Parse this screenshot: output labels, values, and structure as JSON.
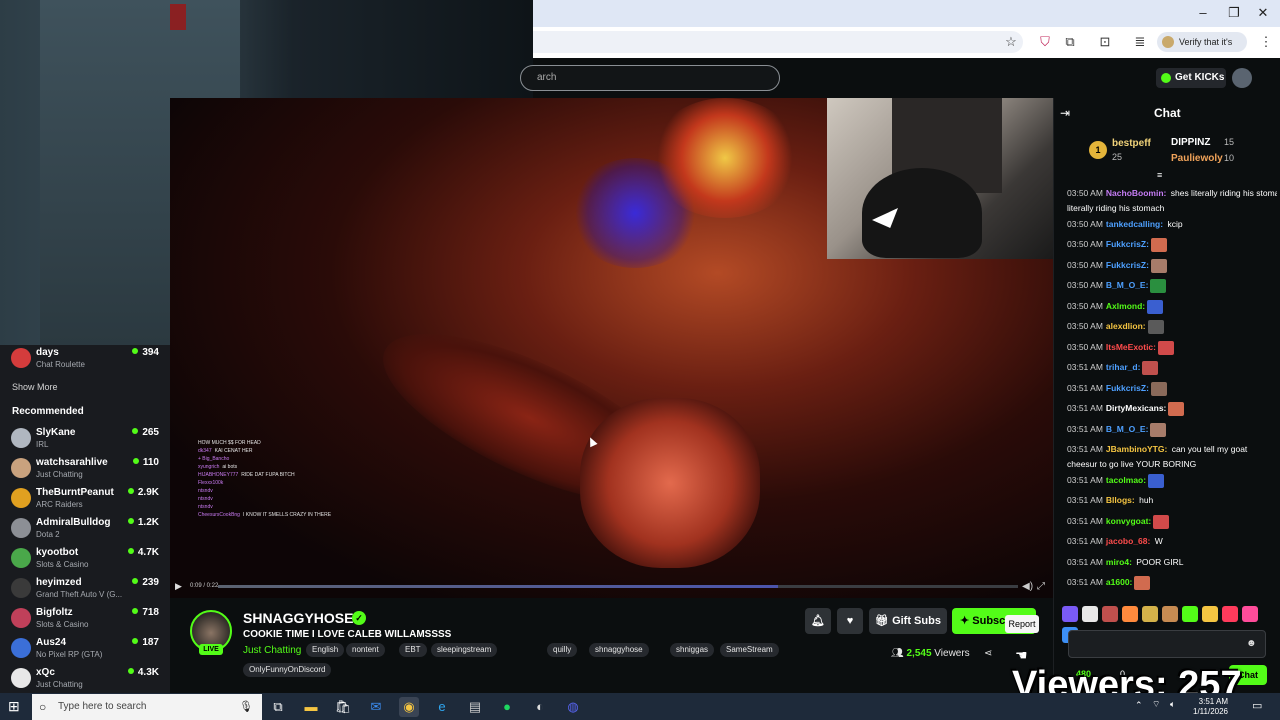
{
  "browser": {
    "search_placeholder": "arch",
    "verify_chip": "Verify that it's you",
    "window_controls": [
      "minimize-icon",
      "restore-icon",
      "close-icon"
    ]
  },
  "kick": {
    "get_kicks": "Get KICKs",
    "brand_color": "#53fc18"
  },
  "sidebar": {
    "following_top": {
      "name": "days",
      "category": "Chat Roulette",
      "viewers": "394"
    },
    "show_more": "Show More",
    "recommended_label": "Recommended",
    "recommended": [
      {
        "name": "SlyKane",
        "category": "IRL",
        "viewers": "265",
        "color": "#b0b7c0"
      },
      {
        "name": "watchsarahlive",
        "category": "Just Chatting",
        "viewers": "110",
        "color": "#c9a27e"
      },
      {
        "name": "TheBurntPeanut",
        "category": "ARC Raiders",
        "viewers": "2.9K",
        "color": "#e0a020"
      },
      {
        "name": "AdmiralBulldog",
        "category": "Dota 2",
        "viewers": "1.2K",
        "color": "#8c8f95"
      },
      {
        "name": "kyootbot",
        "category": "Slots & Casino",
        "viewers": "4.7K",
        "color": "#4aa84a"
      },
      {
        "name": "heyimzed",
        "category": "Grand Theft Auto V (G...",
        "viewers": "239",
        "color": "#3a3a3a"
      },
      {
        "name": "Bigfoltz",
        "category": "Slots & Casino",
        "viewers": "718",
        "color": "#c0405a"
      },
      {
        "name": "Aus24",
        "category": "No Pixel RP (GTA)",
        "viewers": "187",
        "color": "#3b6fd8"
      },
      {
        "name": "xQc",
        "category": "Just Chatting",
        "viewers": "4.3K",
        "color": "#e8e8e8"
      }
    ]
  },
  "player": {
    "time": "0:09 / 0:22",
    "progress": 0.7,
    "overlay_chat": [
      {
        "user": "",
        "text": "HOW MUCH $$ FOR HEAD"
      },
      {
        "user": "dk347",
        "text": "KAI CENAT HER"
      },
      {
        "user": "+ Big_Bancho",
        "text": ""
      },
      {
        "user": "xyungrich",
        "text": "ai bots"
      },
      {
        "user": "HIJABHONEY777",
        "text": "RIDE DAT FUPA BITCH"
      },
      {
        "user": "Flexxx100k",
        "text": ""
      },
      {
        "user": "ntsndv",
        "text": ""
      },
      {
        "user": "ntsndv",
        "text": ""
      },
      {
        "user": "ntsndv",
        "text": ""
      },
      {
        "user": "CheesursCookBng",
        "text": "I KNOW IT SMELLS CRAZY IN THERE"
      }
    ]
  },
  "stream": {
    "streamer": "SHNAGGYHOSE",
    "live": "LIVE",
    "title": "COOKIE TIME I LOVE CALEB WILLAMSSSS",
    "category": "Just Chatting",
    "tags": [
      "English",
      "nontent",
      "EBT",
      "sleepingstream",
      "quilly",
      "shnaggyhose",
      "shniggas",
      "SameStream",
      "OnlyFunnyOnDiscord"
    ],
    "gift_subs": "Gift Subs",
    "subscribe": "Subsc",
    "report_tooltip": "Report",
    "viewers_count": "2,545",
    "viewers_label": "Viewers"
  },
  "chat": {
    "title": "Chat",
    "leaderboard": [
      {
        "rank": "1",
        "name": "bestpeff",
        "count": "25"
      },
      {
        "name": "DIPPINZ",
        "count": "15"
      },
      {
        "name": "Pauliewoly",
        "count": "10"
      }
    ],
    "messages": [
      {
        "time": "03:50 AM",
        "user": "NachoBoomin",
        "color": "#c57cf4",
        "text": "shes literally riding his stomach",
        "wrap": "literally riding his stomach"
      },
      {
        "time": "03:50 AM",
        "user": "tankedcalling",
        "color": "#4ea0ff",
        "text": "kcip"
      },
      {
        "time": "03:50 AM",
        "user": "FukkcrisZ",
        "color": "#4ea0ff",
        "text": ""
      },
      {
        "time": "03:50 AM",
        "user": "FukkcrisZ",
        "color": "#4ea0ff",
        "text": ""
      },
      {
        "time": "03:50 AM",
        "user": "B_M_O_E",
        "color": "#4ea0ff",
        "text": ""
      },
      {
        "time": "03:50 AM",
        "user": "Axlmond",
        "color": "#53fc18",
        "text": ""
      },
      {
        "time": "03:50 AM",
        "user": "alexdlion",
        "color": "#f5c542",
        "text": ""
      },
      {
        "time": "03:50 AM",
        "user": "ItsMeExotic",
        "color": "#ff4c4c",
        "text": ""
      },
      {
        "time": "03:51 AM",
        "user": "trihar_d",
        "color": "#4ea0ff",
        "text": ""
      },
      {
        "time": "03:51 AM",
        "user": "FukkcrisZ",
        "color": "#4ea0ff",
        "text": ""
      },
      {
        "time": "03:51 AM",
        "user": "DirtyMexicans",
        "color": "#ffffff",
        "text": ""
      },
      {
        "time": "03:51 AM",
        "user": "B_M_O_E",
        "color": "#4ea0ff",
        "text": ""
      },
      {
        "time": "03:51 AM",
        "user": "JBambinoYTG",
        "color": "#f5c542",
        "text": "can you tell my goat",
        "wrap": "cheesur to go live YOUR BORING"
      },
      {
        "time": "03:51 AM",
        "user": "tacolmao",
        "color": "#53fc18",
        "text": ""
      },
      {
        "time": "03:51 AM",
        "user": "Bllogs",
        "color": "#f5c542",
        "text": "huh"
      },
      {
        "time": "03:51 AM",
        "user": "konvygoat",
        "color": "#53fc18",
        "text": ""
      },
      {
        "time": "03:51 AM",
        "user": "jacobo_68",
        "color": "#ff4c4c",
        "text": "W"
      },
      {
        "time": "03:51 AM",
        "user": "miro4",
        "color": "#53fc18",
        "text": "POOR GIRL"
      },
      {
        "time": "03:51 AM",
        "user": "a1600",
        "color": "#53fc18",
        "text": ""
      }
    ],
    "footer_count": "480",
    "footer_zero": "0",
    "send": "Chat"
  },
  "overlay_text": "Viewers: 257",
  "taskbar": {
    "search_placeholder": "Type here to search",
    "time": "3:51 AM",
    "date": "1/11/2026"
  }
}
